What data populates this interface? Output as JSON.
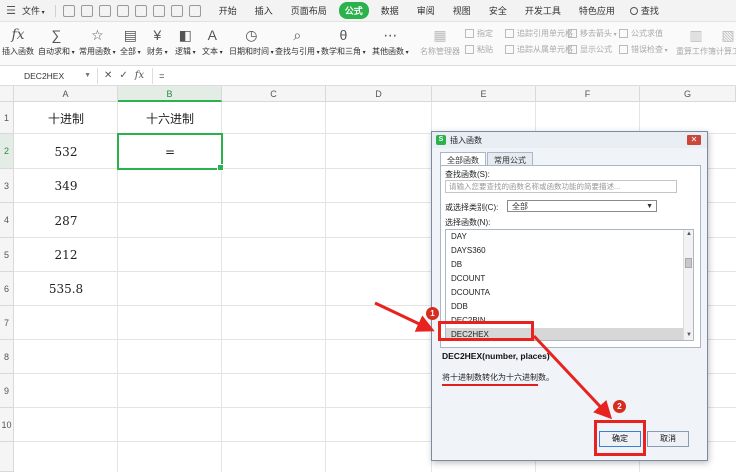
{
  "menubar": {
    "file": "文件",
    "tabs": [
      "开始",
      "插入",
      "页面布局",
      "公式",
      "数据",
      "审阅",
      "视图",
      "安全",
      "开发工具",
      "特色应用"
    ],
    "active_tab": "公式",
    "search": "查找"
  },
  "ribbon": {
    "insert_function": "插入函数",
    "autosum": "自动求和",
    "common": "常用函数",
    "all": "全部",
    "finance": "财务",
    "logic": "逻辑",
    "text": "文本",
    "datetime": "日期和时间",
    "lookup": "查找与引用",
    "math": "数学和三角",
    "other": "其他函数",
    "name_manager": "名称管理器",
    "paste": "粘贴",
    "define": "指定",
    "trace_precedents": "追踪引用单元格",
    "trace_dependents": "追踪从属单元格",
    "remove_arrows": "移去箭头",
    "show_formulas": "显示公式",
    "evaluate": "公式求值",
    "error_check": "错误检查",
    "recalc": "重算工作簿",
    "calc": "计算工"
  },
  "formula_bar": {
    "name_box": "DEC2HEX",
    "content": "="
  },
  "columns": [
    "A",
    "B",
    "C",
    "D",
    "E",
    "F",
    "G"
  ],
  "rows": [
    "1",
    "2",
    "3",
    "4",
    "5",
    "6",
    "7",
    "8",
    "9",
    "10"
  ],
  "cells": {
    "a1": "十进制",
    "b1": "十六进制",
    "a2": "532",
    "b2": "=",
    "a3": "349",
    "a4": "287",
    "a5": "212",
    "a6": "535.8"
  },
  "dialog": {
    "logo": "S",
    "title": "插入函数",
    "tabs": [
      "全部函数",
      "常用公式"
    ],
    "search_label": "查找函数(S):",
    "search_placeholder": "请输入您要查找的函数名称或函数功能的简要描述...",
    "category_label": "或选择类别(C):",
    "category_value": "全部",
    "select_label": "选择函数(N):",
    "functions": [
      "DAY",
      "DAYS360",
      "DB",
      "DCOUNT",
      "DCOUNTA",
      "DDB",
      "DEC2BIN",
      "DEC2HEX"
    ],
    "selected_function": "DEC2HEX",
    "signature": "DEC2HEX(number, places)",
    "description": "将十进制数转化为十六进制数。",
    "ok": "确定",
    "cancel": "取消"
  },
  "annotations": {
    "marker1": "1",
    "marker2": "2",
    "color": "#e8231f"
  }
}
